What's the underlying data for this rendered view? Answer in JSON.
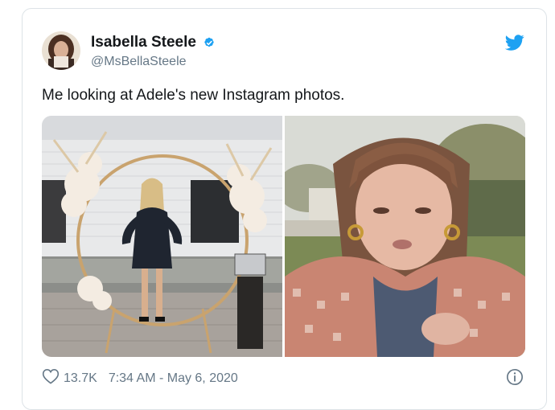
{
  "tweet": {
    "author": {
      "display_name": "Isabella Steele",
      "handle": "@MsBellaSteele",
      "verified_icon": "verified-badge-icon",
      "avatar_icon": "avatar"
    },
    "text": "Me looking at Adele's new Instagram photos.",
    "media": [
      {
        "name": "photo-1",
        "description_icon": "photo"
      },
      {
        "name": "photo-2",
        "description_icon": "photo"
      }
    ],
    "footer": {
      "like_count": "13.7K",
      "timestamp": "7:34 AM - May 6, 2020"
    }
  },
  "colors": {
    "brand_blue": "#1da1f2",
    "like_gray": "#657786",
    "text_primary": "#14171a"
  }
}
